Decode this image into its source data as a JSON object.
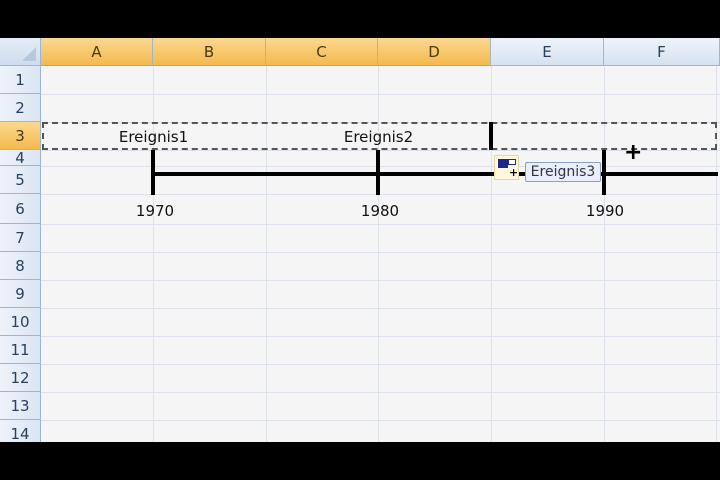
{
  "columns": [
    "A",
    "B",
    "C",
    "D",
    "E",
    "F"
  ],
  "rows": [
    "1",
    "2",
    "3",
    "4",
    "5",
    "6",
    "7",
    "8",
    "9",
    "10",
    "11",
    "12",
    "13",
    "14"
  ],
  "cells": {
    "a3": "Ereignis1",
    "c3": "Ereignis2",
    "b6": "1970",
    "d6": "1980",
    "f6": "1990"
  },
  "tooltip": "Ereignis3"
}
